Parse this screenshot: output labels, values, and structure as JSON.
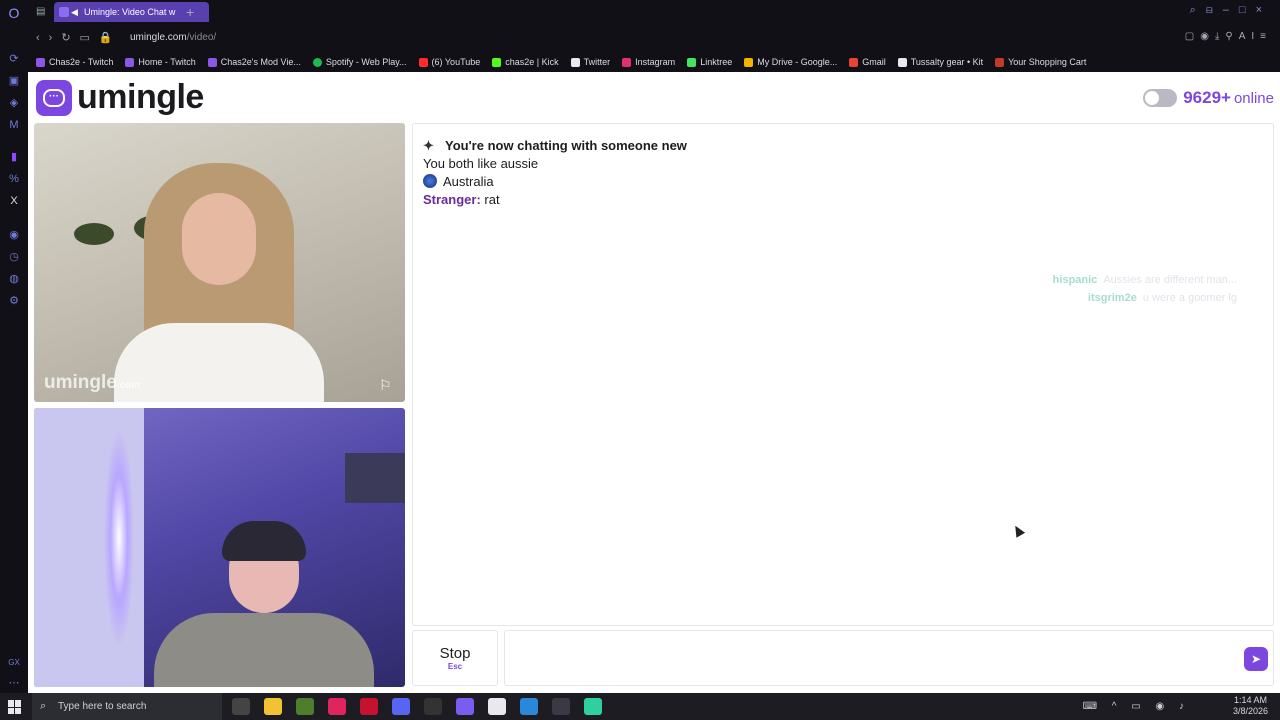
{
  "browser": {
    "tab_title": "Umingle: Video Chat w",
    "url_host": "umingle.com",
    "url_path": "/video/",
    "right_label": "AI",
    "bookmarks": [
      {
        "label": "Chas2e - Twitch",
        "color": "#8e55e8"
      },
      {
        "label": "Home - Twitch",
        "color": "#8e55e8"
      },
      {
        "label": "Chas2e's Mod Vie...",
        "color": "#8e55e8"
      },
      {
        "label": "Spotify - Web Play...",
        "color": "#1db954"
      },
      {
        "label": "(6) YouTube",
        "color": "#ff2b2b"
      },
      {
        "label": "chas2e | Kick",
        "color": "#53fc18"
      },
      {
        "label": "Twitter",
        "color": "#e8e8ee"
      },
      {
        "label": "Instagram",
        "color": "#e1306c"
      },
      {
        "label": "Linktree",
        "color": "#43e55e"
      },
      {
        "label": "My Drive - Google...",
        "color": "#f4b400"
      },
      {
        "label": "Gmail",
        "color": "#ea4335"
      },
      {
        "label": "Tussalty gear • Kit",
        "color": "#e8e8ee"
      },
      {
        "label": "Your Shopping Cart",
        "color": "#c0392b"
      }
    ]
  },
  "site": {
    "logo_text": "umingle",
    "online_count": "9629+",
    "online_label": "online",
    "accent_color": "#7b47e0"
  },
  "video": {
    "watermark": "umingle",
    "watermark_suffix": ".com"
  },
  "chat": {
    "system_message": "You're now chatting with someone new",
    "interest_line": "You both like aussie",
    "country": "Australia",
    "stranger_label": "Stranger:",
    "stranger_message": "rat",
    "overlay_messages": [
      {
        "user": "hispanic",
        "text": "Aussies are different man..."
      },
      {
        "user": "itsgrim2e",
        "text": "u were a goomer lg"
      }
    ]
  },
  "controls": {
    "stop_label": "Stop",
    "stop_key": "Esc",
    "message_placeholder": ""
  },
  "taskbar": {
    "search_placeholder": "Type here to search",
    "time": "1:14 AM",
    "date": "3/8/2026"
  }
}
